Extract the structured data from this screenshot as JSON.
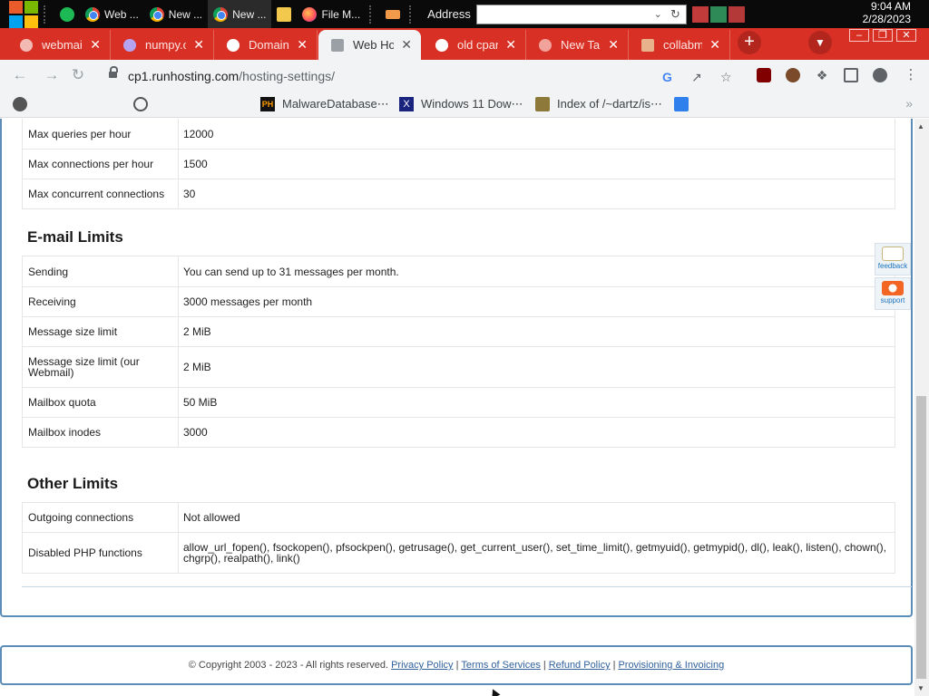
{
  "taskbar": {
    "apps": [
      {
        "label": "Web ...",
        "icon": "chrome-icon"
      },
      {
        "label": "New ...",
        "icon": "chrome-icon"
      },
      {
        "label": "New ...",
        "icon": "chrome-icon"
      },
      {
        "label": "",
        "icon": "folder-icon"
      },
      {
        "label": "File M...",
        "icon": "firefox-icon"
      }
    ],
    "address_label": "Address",
    "time": "9:04 AM",
    "date": "2/28/2023"
  },
  "tabs": [
    {
      "title": "webmail",
      "icon": "webmail-favicon"
    },
    {
      "title": "numpy.c",
      "icon": "numpy-favicon"
    },
    {
      "title": "Domain i",
      "icon": "domain-favicon"
    },
    {
      "title": "Web Ho",
      "icon": "page-favicon",
      "active": true
    },
    {
      "title": "old cpar",
      "icon": "google-favicon"
    },
    {
      "title": "New Tab",
      "icon": "chrome-favicon"
    },
    {
      "title": "collabma",
      "icon": "collabma-favicon"
    }
  ],
  "address": {
    "host": "cp1.runhosting.com",
    "path": "/hosting-settings/"
  },
  "bookmarks": [
    {
      "label": "",
      "icon": "bookmark-favicon"
    },
    {
      "label": "",
      "icon": "globe-icon"
    },
    {
      "label": "MalwareDatabase⋯",
      "icon": "ph-favicon"
    },
    {
      "label": "Windows 11 Dow⋯",
      "icon": "x-favicon"
    },
    {
      "label": "Index of /~dartz/is⋯",
      "icon": "folder-favicon"
    },
    {
      "label": "",
      "icon": "bookmark-favicon"
    }
  ],
  "database_rows": [
    {
      "label": "Max queries per hour",
      "value": "12000"
    },
    {
      "label": "Max connections per hour",
      "value": "1500"
    },
    {
      "label": "Max concurrent connections",
      "value": "30"
    }
  ],
  "email_section": {
    "title": "E-mail Limits",
    "rows": [
      {
        "label": "Sending",
        "value": "You can send up to 31 messages per month."
      },
      {
        "label": "Receiving",
        "value": "3000 messages per month"
      },
      {
        "label": "Message size limit",
        "value": "2 MiB"
      },
      {
        "label": "Message size limit (our Webmail)",
        "value": "2 MiB"
      },
      {
        "label": "Mailbox quota",
        "value": "50 MiB"
      },
      {
        "label": "Mailbox inodes",
        "value": "3000"
      }
    ]
  },
  "other_section": {
    "title": "Other Limits",
    "rows": [
      {
        "label": "Outgoing connections",
        "value": "Not allowed"
      },
      {
        "label": "Disabled PHP functions",
        "value": "allow_url_fopen(), fsockopen(), pfsockpen(), getrusage(), get_current_user(), set_time_limit(), getmyuid(), getmypid(), dl(), leak(), listen(), chown(), chgrp(), realpath(), link()"
      }
    ]
  },
  "footer": {
    "copyright": "© Copyright 2003 - 2023 - All rights reserved.",
    "links": [
      "Privacy Policy",
      "Terms of Services",
      "Refund Policy",
      "Provisioning & Invoicing"
    ]
  },
  "side_widgets": {
    "feedback": "feedback",
    "support": "support"
  },
  "colors": {
    "tab_strip": "#d93025",
    "panel_border": "#5b8db8",
    "link": "#30609c"
  }
}
